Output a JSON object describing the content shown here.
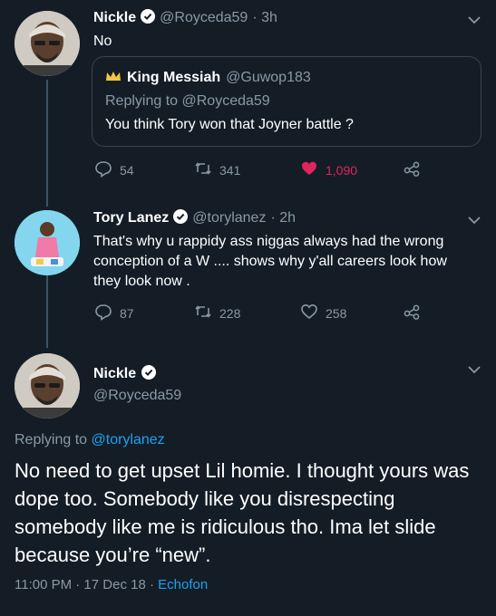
{
  "tweet1": {
    "name": "Nickle",
    "handle": "@Royceda59",
    "time": "· 3h",
    "text": "No",
    "quote": {
      "name": "King Messiah",
      "handle": "@Guwop183",
      "replying_prefix": "Replying to",
      "replying_to": "@Royceda59",
      "text": "You think Tory won that Joyner battle ?"
    },
    "replies": "54",
    "retweets": "341",
    "likes": "1,090"
  },
  "tweet2": {
    "name": "Tory Lanez",
    "handle": "@torylanez",
    "time": "· 2h",
    "text": "That's why u rappidy ass niggas always had the wrong conception of a W .... shows why y'all careers look how they look now .",
    "replies": "87",
    "retweets": "228",
    "likes": "258"
  },
  "tweet3": {
    "name": "Nickle",
    "handle": "@Royceda59",
    "replying_prefix": "Replying to",
    "replying_to": "@torylanez",
    "text": "No need to get upset Lil homie. I thought yours was dope too. Somebody like you disrespecting somebody like me is ridiculous tho. Ima let slide because you’re “new”.",
    "timestamp": "11:00 PM · 17 Dec 18 · ",
    "client": "Echofon"
  },
  "colors": {
    "background": "#141d26",
    "secondary_text": "#8899a6",
    "link": "#1da1f2",
    "like_active": "#e0245e",
    "border": "#38444d"
  }
}
